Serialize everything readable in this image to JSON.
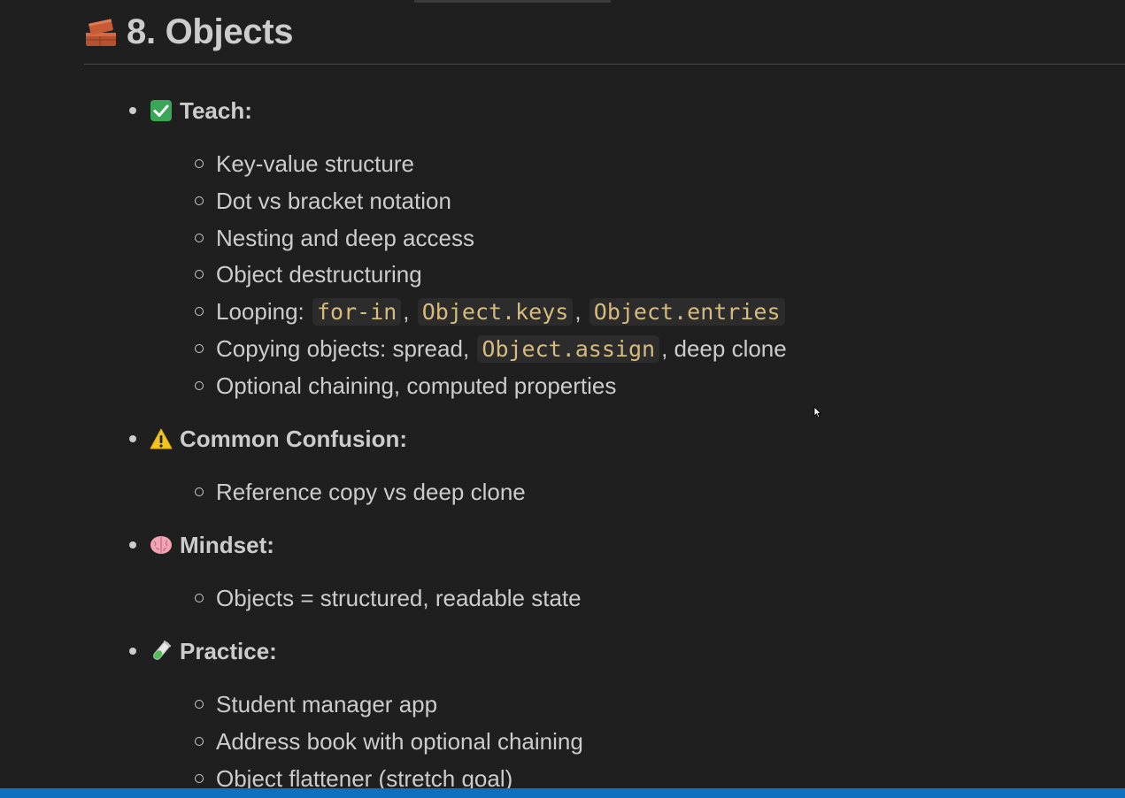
{
  "heading": {
    "icon": "bricks-icon",
    "title": "8. Objects"
  },
  "sections": {
    "teach": {
      "icon": "check-mark-button-icon",
      "label": "Teach:",
      "items": {
        "0": {
          "text": "Key-value structure"
        },
        "1": {
          "text": "Dot vs bracket notation"
        },
        "2": {
          "text": "Nesting and deep access"
        },
        "3": {
          "text": "Object destructuring"
        },
        "4": {
          "prefix": "Looping: ",
          "code1": "for-in",
          "sep1": ", ",
          "code2": "Object.keys",
          "sep2": ", ",
          "code3": "Object.entries"
        },
        "5": {
          "prefix": "Copying objects: spread, ",
          "code1": "Object.assign",
          "suffix": ", deep clone"
        },
        "6": {
          "text": "Optional chaining, computed properties"
        }
      }
    },
    "confusion": {
      "icon": "warning-icon",
      "label": "Common Confusion:",
      "items": {
        "0": {
          "text": "Reference copy vs deep clone"
        }
      }
    },
    "mindset": {
      "icon": "brain-icon",
      "label": "Mindset:",
      "items": {
        "0": {
          "text": "Objects = structured, readable state"
        }
      }
    },
    "practice": {
      "icon": "test-tube-icon",
      "label": "Practice:",
      "items": {
        "0": {
          "text": "Student manager app"
        },
        "1": {
          "text": "Address book with optional chaining"
        },
        "2": {
          "text": "Object flattener (stretch goal)"
        }
      }
    }
  },
  "colors": {
    "background": "#1f1f1f",
    "text": "#cccccc",
    "code_text": "#d7ba7d",
    "code_bg": "#2c2c2c",
    "status_bar": "#0f6fc0"
  }
}
